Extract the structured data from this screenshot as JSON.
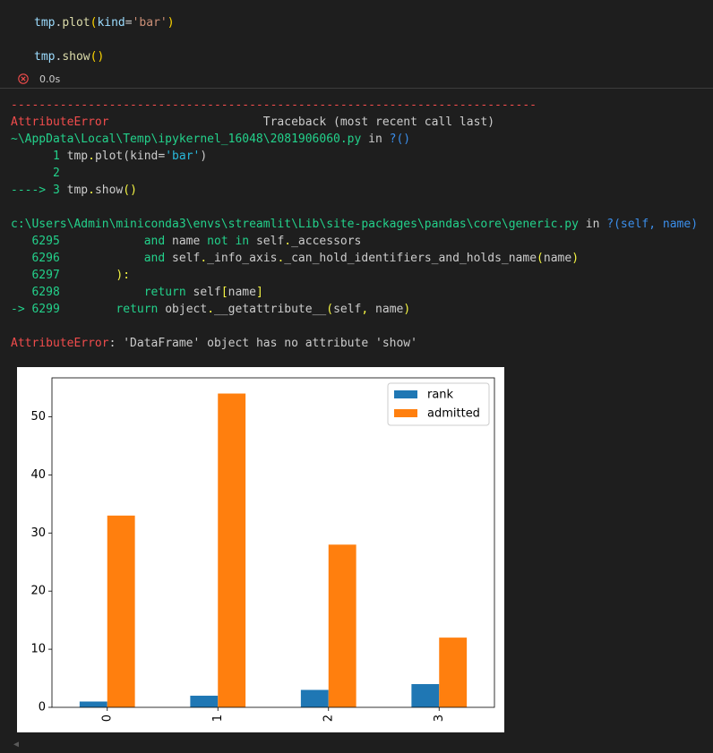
{
  "cell": {
    "lines": [
      {
        "obj": "tmp",
        "dot": ".",
        "method": "plot",
        "open": "(",
        "arg_name": "kind",
        "eq": "=",
        "arg_value": "'bar'",
        "close": ")"
      },
      {
        "obj": "tmp",
        "dot": ".",
        "method": "show",
        "open": "()",
        "close": ""
      }
    ],
    "exec_time": "0.0s",
    "status_icon": "error-circle-icon"
  },
  "traceback": {
    "separator": "---------------------------------------------------------------------------",
    "error_name": "AttributeError",
    "header_right": "Traceback (most recent call last)",
    "frame1": {
      "path": "~\\AppData\\Local\\Temp\\ipykernel_16048\\2081906060.py",
      "in": " in ",
      "func": "?()",
      "lines": [
        {
          "prefix": "      1 ",
          "code_a": "tmp",
          "code_b": ".",
          "code_c": "plot(kind=",
          "code_d": "'bar'",
          "code_e": ")"
        },
        {
          "prefix": "      2",
          "code": ""
        },
        {
          "prefix": "----> 3 ",
          "code_a": "tmp",
          "code_b": ".",
          "code_c": "show",
          "code_d": "()"
        }
      ]
    },
    "frame2": {
      "path": "c:\\Users\\Admin\\miniconda3\\envs\\streamlit\\Lib\\site-packages\\pandas\\core\\generic.py",
      "in": " in ",
      "func": "?(self, name)",
      "lines": [
        {
          "num": "   6295",
          "indent": "            ",
          "kw1": "and",
          "t1": " name ",
          "kw2": "not in",
          "t2": " self",
          "dot": ".",
          "t3": "_accessors"
        },
        {
          "num": "   6296",
          "indent": "            ",
          "kw1": "and",
          "t1": " self",
          "dot1": ".",
          "t2": "_info_axis",
          "dot2": ".",
          "t3": "_can_hold_identifiers_and_holds_name",
          "p1": "(",
          "t4": "name",
          "p2": ")"
        },
        {
          "num": "   6297",
          "indent": "        ",
          "t1": "):"
        },
        {
          "num": "   6298",
          "indent": "            ",
          "kw1": "return",
          "t1": " self",
          "p1": "[",
          "t2": "name",
          "p2": "]"
        },
        {
          "num": "-> 6299",
          "indent": "        ",
          "kw1": "return",
          "t1": " object",
          "dot": ".",
          "t2": "__getattribute__",
          "p1": "(",
          "t3": "self",
          "comma": ",",
          "t4": " name",
          "p2": ")"
        }
      ]
    },
    "final_error_name": "AttributeError",
    "final_message": ": 'DataFrame' object has no attribute 'show'"
  },
  "chart_data": {
    "type": "bar",
    "categories": [
      "0",
      "1",
      "2",
      "3"
    ],
    "series": [
      {
        "name": "rank",
        "values": [
          1,
          2,
          3,
          4
        ],
        "color": "#1f77b4"
      },
      {
        "name": "admitted",
        "values": [
          33,
          54,
          28,
          12
        ],
        "color": "#ff7f0e"
      }
    ],
    "ylim": [
      0,
      56.7
    ],
    "yticks": [
      0,
      10,
      20,
      30,
      40,
      50
    ],
    "xlabel": "",
    "ylabel": "",
    "title": "",
    "legend": "top-right",
    "grid": false
  },
  "colors": {
    "background": "#1e1e1e",
    "error_red": "#f14c4c",
    "path_green": "#23d18b"
  }
}
